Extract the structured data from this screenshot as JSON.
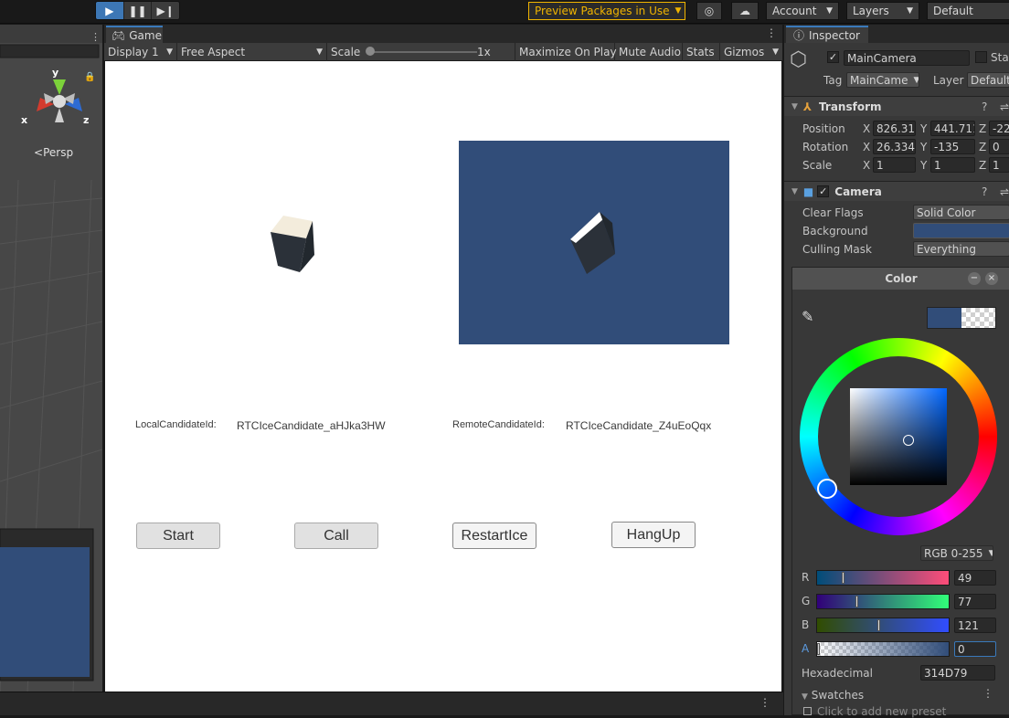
{
  "toolbar": {
    "play_icon": "play-icon",
    "pause_icon": "pause-icon",
    "step_icon": "step-icon",
    "preview_packages": "Preview Packages in Use",
    "account": "Account",
    "layers": "Layers",
    "layout": "Default"
  },
  "scene": {
    "gizmo_y": "y",
    "gizmo_x": "x",
    "gizmo_z": "z",
    "persp": "Persp"
  },
  "game": {
    "tab_label": "Game",
    "display": "Display 1",
    "aspect": "Free Aspect",
    "scale_label": "Scale",
    "scale_value": "1x",
    "maximize": "Maximize On Play",
    "mute": "Mute Audio",
    "stats": "Stats",
    "gizmos": "Gizmos",
    "local_label": "LocalCandidateId:",
    "local_value": "RTCIceCandidate_aHJka3HW",
    "remote_label": "RemoteCandidateId:",
    "remote_value": "RTCIceCandidate_Z4uEoQqx",
    "buttons": [
      "Start",
      "Call",
      "RestartIce",
      "HangUp"
    ],
    "remote_bg": "#314D79"
  },
  "inspector": {
    "tab_label": "Inspector",
    "object_name": "MainCamera",
    "static_label": "Sta",
    "tag_label": "Tag",
    "tag_value": "MainCame",
    "layer_label": "Layer",
    "layer_value": "Default",
    "transform": {
      "header": "Transform",
      "position_label": "Position",
      "rotation_label": "Rotation",
      "scale_label": "Scale",
      "pos": [
        "826.316",
        "441.711",
        "-22"
      ],
      "rot": [
        "26.334",
        "-135",
        "0"
      ],
      "scl": [
        "1",
        "1",
        "1"
      ],
      "axis_x": "X",
      "axis_y": "Y",
      "axis_z": "Z"
    },
    "camera": {
      "header": "Camera",
      "clear_flags_label": "Clear Flags",
      "clear_flags_value": "Solid Color",
      "background_label": "Background",
      "culling_label": "Culling Mask",
      "culling_value": "Everything"
    }
  },
  "color_picker": {
    "title": "Color",
    "mode": "RGB 0-255",
    "r_label": "R",
    "g_label": "G",
    "b_label": "B",
    "a_label": "A",
    "r": "49",
    "g": "77",
    "b": "121",
    "a": "0",
    "r_level": 0.19,
    "g_level": 0.3,
    "b_level": 0.47,
    "a_level": 0,
    "hex_label": "Hexadecimal",
    "hex": "314D79",
    "swatches_label": "Swatches",
    "add_preset": "Click to add new preset",
    "color": "#314D79"
  }
}
